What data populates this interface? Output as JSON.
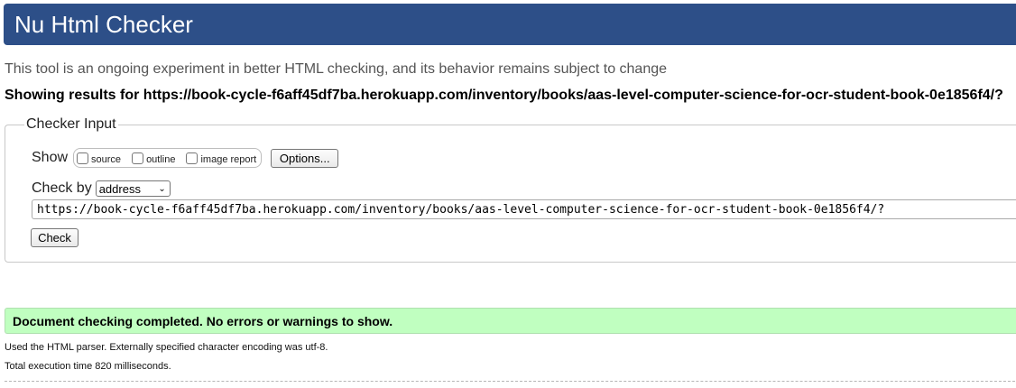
{
  "header": {
    "title": "Nu Html Checker"
  },
  "tagline": "This tool is an ongoing experiment in better HTML checking, and its behavior remains subject to change",
  "showing_results": "Showing results for https://book-cycle-f6aff45df7ba.herokuapp.com/inventory/books/aas-level-computer-science-for-ocr-student-book-0e1856f4/?",
  "checker_input": {
    "legend": "Checker Input",
    "show_label": "Show",
    "show_options": [
      {
        "label": "source",
        "checked": false
      },
      {
        "label": "outline",
        "checked": false
      },
      {
        "label": "image report",
        "checked": false
      }
    ],
    "options_button": "Options...",
    "check_by_label": "Check by",
    "check_by_selected": "address",
    "url_value": "https://book-cycle-f6aff45df7ba.herokuapp.com/inventory/books/aas-level-computer-science-for-ocr-student-book-0e1856f4/?",
    "check_button": "Check"
  },
  "result": {
    "message": "Document checking completed. No errors or warnings to show.",
    "parser_info": "Used the HTML parser. Externally specified character encoding was utf-8.",
    "execution_time": "Total execution time 820 milliseconds."
  },
  "colors": {
    "header_bg": "#2d4f88",
    "success_bg": "#c0ffc0"
  }
}
